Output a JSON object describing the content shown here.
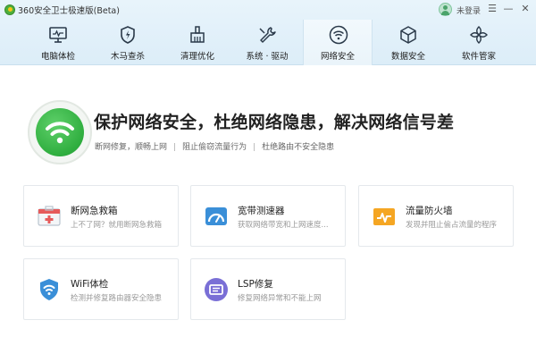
{
  "app": {
    "title": "360安全卫士极速版(Beta)",
    "login_label": "未登录",
    "window_controls": [
      "☰",
      "—",
      "✕"
    ]
  },
  "nav": {
    "items": [
      {
        "label": "电脑体检",
        "icon": "monitor-icon"
      },
      {
        "label": "木马查杀",
        "icon": "shield-bolt-icon"
      },
      {
        "label": "清理优化",
        "icon": "broom-icon"
      },
      {
        "label": "系统 · 驱动",
        "icon": "wrench-icon"
      },
      {
        "label": "网络安全",
        "icon": "wifi-icon"
      },
      {
        "label": "数据安全",
        "icon": "cube-icon"
      },
      {
        "label": "软件管家",
        "icon": "apps-icon"
      }
    ],
    "active_index": 4
  },
  "hero": {
    "title": "保护网络安全，杜绝网络隐患，解决网络信号差",
    "features": [
      "断网修复，顺畅上网",
      "阻止偷窃流量行为",
      "杜绝路由不安全隐患"
    ],
    "separator": "|",
    "icon": "wifi-icon"
  },
  "tools": [
    {
      "title": "断网急救箱",
      "desc": "上不了网？就用断网急救箱",
      "icon": "first-aid-kit-icon"
    },
    {
      "title": "宽带测速器",
      "desc": "获取网络带宽和上网速度...",
      "icon": "speedometer-icon"
    },
    {
      "title": "流量防火墙",
      "desc": "发现并阻止偷占流量的程序",
      "icon": "traffic-firewall-icon"
    },
    {
      "title": "WiFi体检",
      "desc": "检测并修复路由器安全隐患",
      "icon": "wifi-shield-icon"
    },
    {
      "title": "LSP修复",
      "desc": "修复网络异常和不能上网",
      "icon": "lsp-repair-icon"
    }
  ],
  "colors": {
    "accent_green": "#2fae3f",
    "header_bg": "#dcedf8",
    "tool_red": "#e65b5b",
    "tool_blue": "#3a8fd8",
    "tool_orange": "#f5a623",
    "tool_purple": "#7a6fd6"
  }
}
